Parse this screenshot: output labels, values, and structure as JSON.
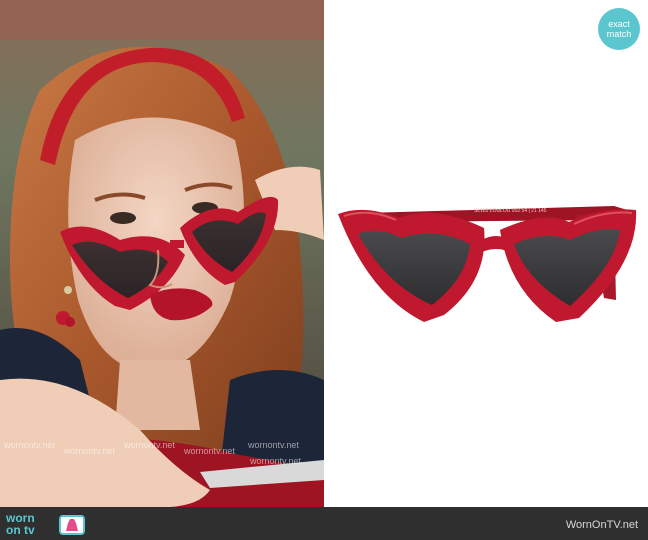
{
  "badge": {
    "line1": "exact",
    "line2": "match"
  },
  "watermarks": [
    "wornontv.net",
    "wornontv.net",
    "wornontv.net",
    "wornontv.net",
    "wornontv.net",
    "wornontv.net"
  ],
  "product": {
    "temple_text": "SL181 LOULOU 002 54 | 21 145"
  },
  "footer": {
    "logo_line1": "worn",
    "logo_line2": "on tv",
    "site": "WornOnTV.net"
  },
  "colors": {
    "accent": "#5cc6cf",
    "frame_red": "#c0182e",
    "footer_bg": "#2f2f2f"
  }
}
